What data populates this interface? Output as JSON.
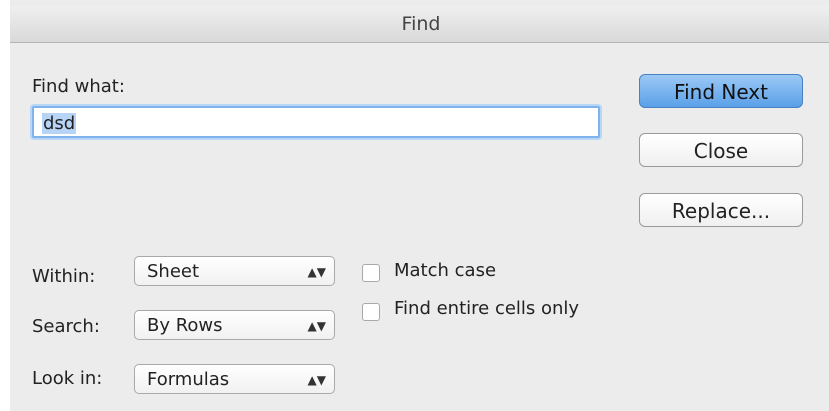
{
  "window": {
    "title": "Find"
  },
  "find": {
    "label": "Find what:",
    "value": "dsd"
  },
  "buttons": {
    "find_next": "Find Next",
    "close": "Close",
    "replace": "Replace..."
  },
  "options": {
    "within": {
      "label": "Within:",
      "value": "Sheet"
    },
    "search": {
      "label": "Search:",
      "value": "By Rows"
    },
    "look_in": {
      "label": "Look in:",
      "value": "Formulas"
    }
  },
  "checkboxes": {
    "match_case": {
      "label": "Match case",
      "checked": false
    },
    "entire_cells": {
      "label": "Find entire cells only",
      "checked": false
    }
  },
  "icons": {
    "select_arrows": "⌃⌄"
  },
  "colors": {
    "default_button": "#5aa0e8",
    "focus_ring": "#7fb3ec"
  }
}
